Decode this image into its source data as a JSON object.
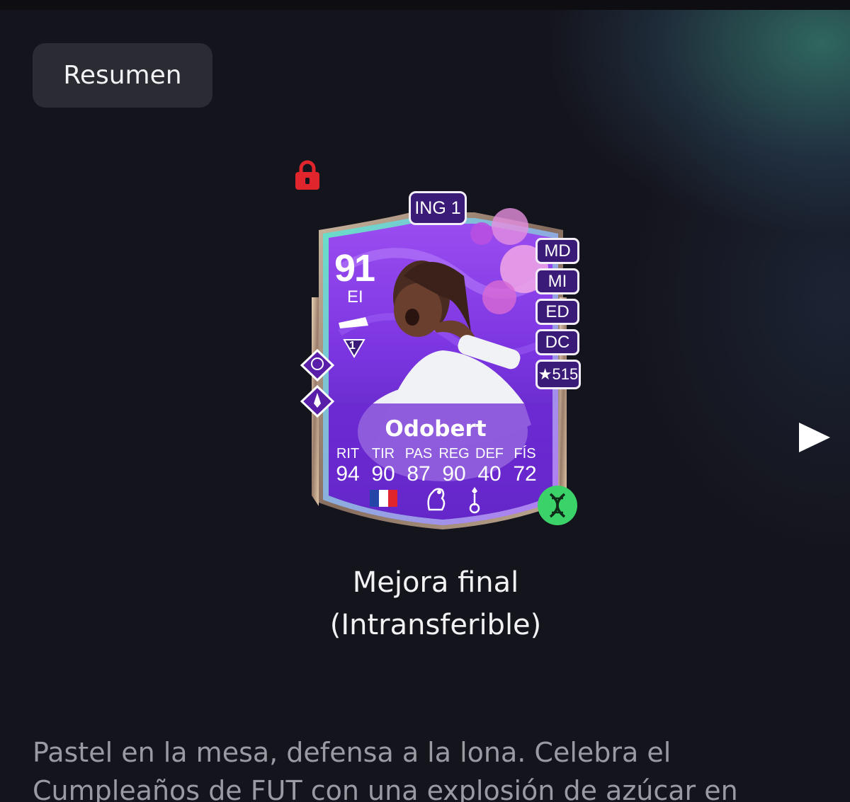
{
  "summary_button": {
    "label": "Resumen"
  },
  "card": {
    "chemistry_style": "ING 1",
    "rating": "91",
    "position": "EI",
    "alt_positions": [
      "MD",
      "MI",
      "ED",
      "DC"
    ],
    "skill_weak": "★515",
    "playstyle_level": "1",
    "player_name": "Odobert",
    "stats": [
      {
        "label": "RIT",
        "value": "94"
      },
      {
        "label": "TIR",
        "value": "90"
      },
      {
        "label": "PAS",
        "value": "87"
      },
      {
        "label": "REG",
        "value": "90"
      },
      {
        "label": "DEF",
        "value": "40"
      },
      {
        "label": "FÍS",
        "value": "72"
      }
    ],
    "icons": {
      "lock": "lock-icon",
      "evolution": "dna-icon",
      "nation": "france-flag-icon",
      "league": "premier-league-icon",
      "club": "tottenham-crest-icon"
    }
  },
  "reward": {
    "title_line1": "Mejora final",
    "title_line2": "(Intransferible)"
  },
  "description": "Pastel en la mesa, defensa a la lona. Celebra el Cumpleaños de FUT con una explosión de azúcar en",
  "colors": {
    "background": "#14141c",
    "button": "#2a2b33",
    "lock": "#e0262c",
    "evo_badge": "#3cd26a",
    "card_purple": "#6a2bd8"
  }
}
